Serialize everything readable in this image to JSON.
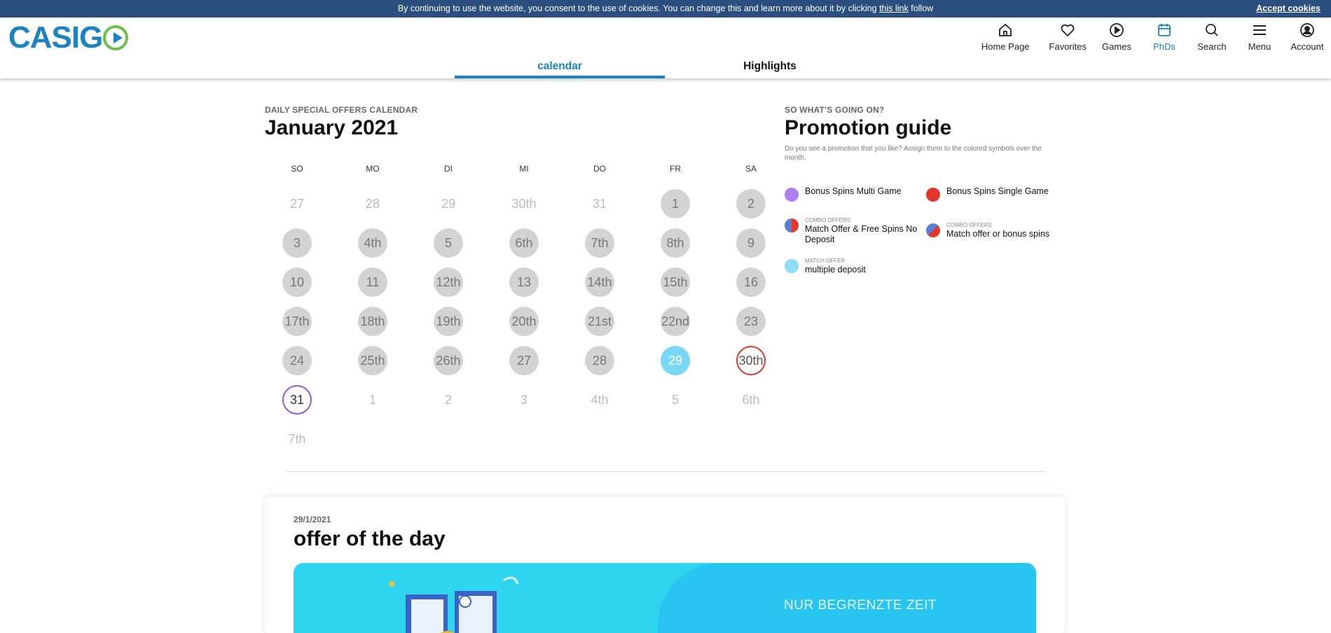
{
  "cookie": {
    "text_before": "By continuing to use the website, you consent to the use of cookies. You can change this and learn more about it by clicking ",
    "link": "this link",
    "text_after": " follow",
    "accept": "Accept cookies"
  },
  "logo": {
    "part1": "CASI",
    "part2": "G"
  },
  "nav": [
    {
      "label": "Home Page",
      "icon": "home-icon"
    },
    {
      "label": "Favorites",
      "icon": "heart-icon"
    },
    {
      "label": "Games",
      "icon": "play-icon"
    },
    {
      "label": "PhDs",
      "icon": "calendar-icon",
      "active": true
    },
    {
      "label": "Search",
      "icon": "search-icon"
    },
    {
      "label": "Menu",
      "icon": "menu-icon"
    },
    {
      "label": "Account",
      "icon": "user-icon"
    }
  ],
  "tabs": {
    "calendar": "calendar",
    "highlights": "Highlights"
  },
  "calendar": {
    "eyebrow": "DAILY SPECIAL OFFERS CALENDAR",
    "title": "January 2021",
    "weekdays": [
      "SO",
      "MO",
      "DI",
      "MI",
      "DO",
      "FR",
      "SA"
    ],
    "weeks": [
      [
        [
          "27",
          "out"
        ],
        [
          "28",
          "out"
        ],
        [
          "29",
          "out"
        ],
        [
          "30th",
          "out"
        ],
        [
          "31",
          "out"
        ],
        [
          "1",
          "grey"
        ],
        [
          "2",
          "grey"
        ]
      ],
      [
        [
          "3",
          "grey"
        ],
        [
          "4th",
          "grey"
        ],
        [
          "5",
          "grey"
        ],
        [
          "6th",
          "grey"
        ],
        [
          "7th",
          "grey"
        ],
        [
          "8th",
          "grey"
        ],
        [
          "9",
          "grey"
        ]
      ],
      [
        [
          "10",
          "grey"
        ],
        [
          "11",
          "grey"
        ],
        [
          "12th",
          "grey"
        ],
        [
          "13",
          "grey"
        ],
        [
          "14th",
          "grey"
        ],
        [
          "15th",
          "grey"
        ],
        [
          "16",
          "grey"
        ]
      ],
      [
        [
          "17th",
          "grey"
        ],
        [
          "18th",
          "grey"
        ],
        [
          "19th",
          "grey"
        ],
        [
          "20th",
          "grey"
        ],
        [
          "21st",
          "grey"
        ],
        [
          "22nd",
          "grey"
        ],
        [
          "23",
          "grey"
        ]
      ],
      [
        [
          "24",
          "grey"
        ],
        [
          "25th",
          "grey"
        ],
        [
          "26th",
          "grey"
        ],
        [
          "27",
          "grey"
        ],
        [
          "28",
          "grey"
        ],
        [
          "29",
          "match"
        ],
        [
          "30th",
          "ring-red"
        ]
      ],
      [
        [
          "31",
          "ring-purple"
        ],
        [
          "1",
          "out"
        ],
        [
          "2",
          "out"
        ],
        [
          "3",
          "out"
        ],
        [
          "4th",
          "out"
        ],
        [
          "5",
          "out"
        ],
        [
          "6th",
          "out"
        ]
      ],
      [
        [
          "7th",
          "out"
        ]
      ]
    ]
  },
  "guide": {
    "eyebrow": "SO WHAT'S GOING ON?",
    "title": "Promotion guide",
    "desc": "Do you see a promotion that you like? Assign them to the colored symbols over the month.",
    "items": {
      "multi": {
        "sub": "",
        "label": "Bonus Spins Multi Game"
      },
      "single": {
        "sub": "",
        "label": "Bonus Spins Single Game"
      },
      "combo1": {
        "sub": "COMBO OFFERS",
        "label": "Match Offer & Free Spins No Deposit"
      },
      "combo2": {
        "sub": "COMBO OFFERS",
        "label": "Match offer or bonus spins"
      },
      "match": {
        "sub": "MATCH OFFER",
        "label": "multiple deposit"
      }
    }
  },
  "offer": {
    "date": "29/1/2021",
    "title": "offer of the day",
    "banner_text": "NUR BEGRENZTE ZEIT"
  },
  "colors": {
    "brand_blue": "#1d82c2",
    "brand_green": "#6dbf4b",
    "match_cyan": "#79d8f6"
  }
}
